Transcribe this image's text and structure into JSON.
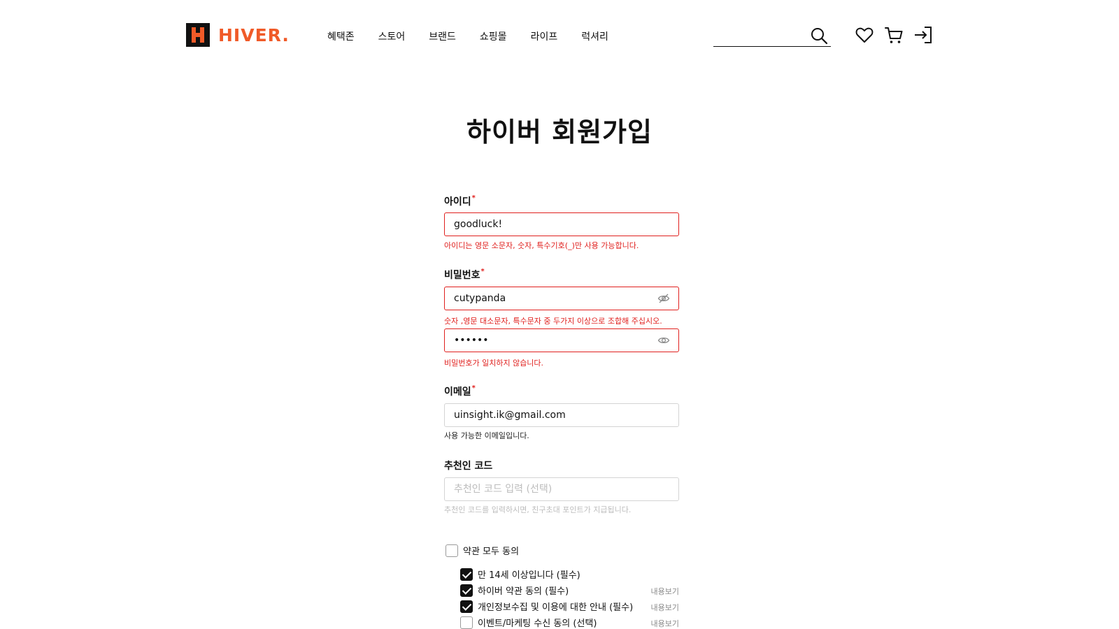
{
  "brand": {
    "name": "HIVER.",
    "color": "#f05a28"
  },
  "nav": {
    "items": [
      {
        "label": "혜택존"
      },
      {
        "label": "스토어"
      },
      {
        "label": "브랜드"
      },
      {
        "label": "쇼핑몰"
      },
      {
        "label": "라이프"
      },
      {
        "label": "럭셔리"
      }
    ]
  },
  "search": {
    "value": "",
    "icon": "search-icon"
  },
  "utility_icons": [
    "heart-icon",
    "cart-icon",
    "login-icon"
  ],
  "page": {
    "title": "하이버 회원가입"
  },
  "form": {
    "id": {
      "label": "아이디",
      "required_mark": "*",
      "value": "goodluck!",
      "error": "아이디는 영문 소문자, 숫자, 특수기호(_)만 사용 가능합니다."
    },
    "password": {
      "label": "비밀번호",
      "required_mark": "*",
      "value": "cutypanda",
      "error": "숫자 ,영문 대소문자, 특수문자 중 두가지 이상으로 조합해 주십시오.",
      "confirm_value": "••••••",
      "confirm_error": "비밀번호가 일치하지 않습니다."
    },
    "email": {
      "label": "이메일",
      "required_mark": "*",
      "value": "uinsight.ik@gmail.com",
      "message": "사용 가능한 이메일입니다."
    },
    "referral": {
      "label": "추천인 코드",
      "placeholder": "추천인 코드 입력 (선택)",
      "hint": "추천인 코드를 입력하시면, 친구초대 포인트가 지급됩니다."
    }
  },
  "terms": {
    "all": {
      "label": "약관 모두 동의",
      "checked": false
    },
    "items": [
      {
        "label": "만 14세 이상입니다 (필수)",
        "checked": true,
        "link": ""
      },
      {
        "label": "하이버 약관 동의 (필수)",
        "checked": true,
        "link": "내용보기"
      },
      {
        "label": "개인정보수집 및 이용에 대한 안내 (필수)",
        "checked": true,
        "link": "내용보기"
      },
      {
        "label": "이벤트/마케팅 수신 동의 (선택)",
        "checked": false,
        "link": "내용보기"
      }
    ]
  },
  "colors": {
    "error": "#e0201e",
    "border": "#d4d4d4",
    "hint": "#bdbdbd"
  }
}
